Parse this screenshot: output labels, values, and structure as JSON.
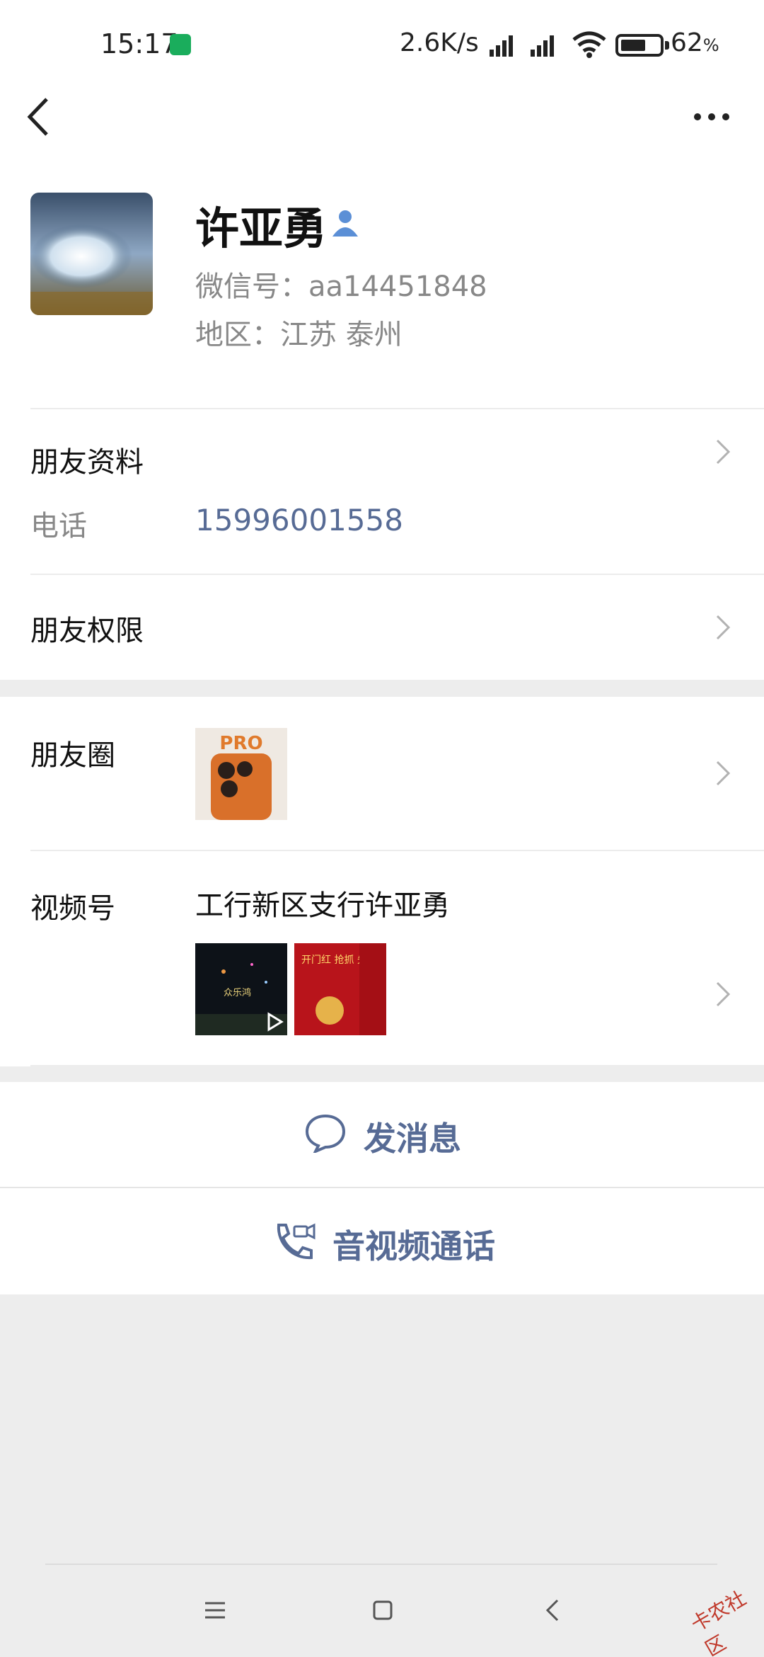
{
  "status_bar": {
    "time": "15:17",
    "net_speed": "2.6K/s",
    "battery": "62",
    "battery_unit": "%"
  },
  "profile": {
    "name": "许亚勇",
    "wechat_id": "微信号：aa14451848",
    "region": "地区：江苏  泰州"
  },
  "friend_info": {
    "title": "朋友资料",
    "phone_label": "电话",
    "phone_value": "15996001558"
  },
  "permissions": {
    "title": "朋友权限"
  },
  "moments": {
    "title": "朋友圈",
    "thumb_text": "PRO"
  },
  "channels": {
    "title": "视频号",
    "name": "工行新区支行许亚勇",
    "thumb1_text": "众乐鸿",
    "thumb2_text": "开门红 抢抓 先机"
  },
  "actions": {
    "message": "发消息",
    "call": "音视频通话"
  },
  "watermark": "卡农社区",
  "colors": {
    "link": "#576b95",
    "background": "#ededed",
    "status_call_green": "#1aad5c"
  }
}
